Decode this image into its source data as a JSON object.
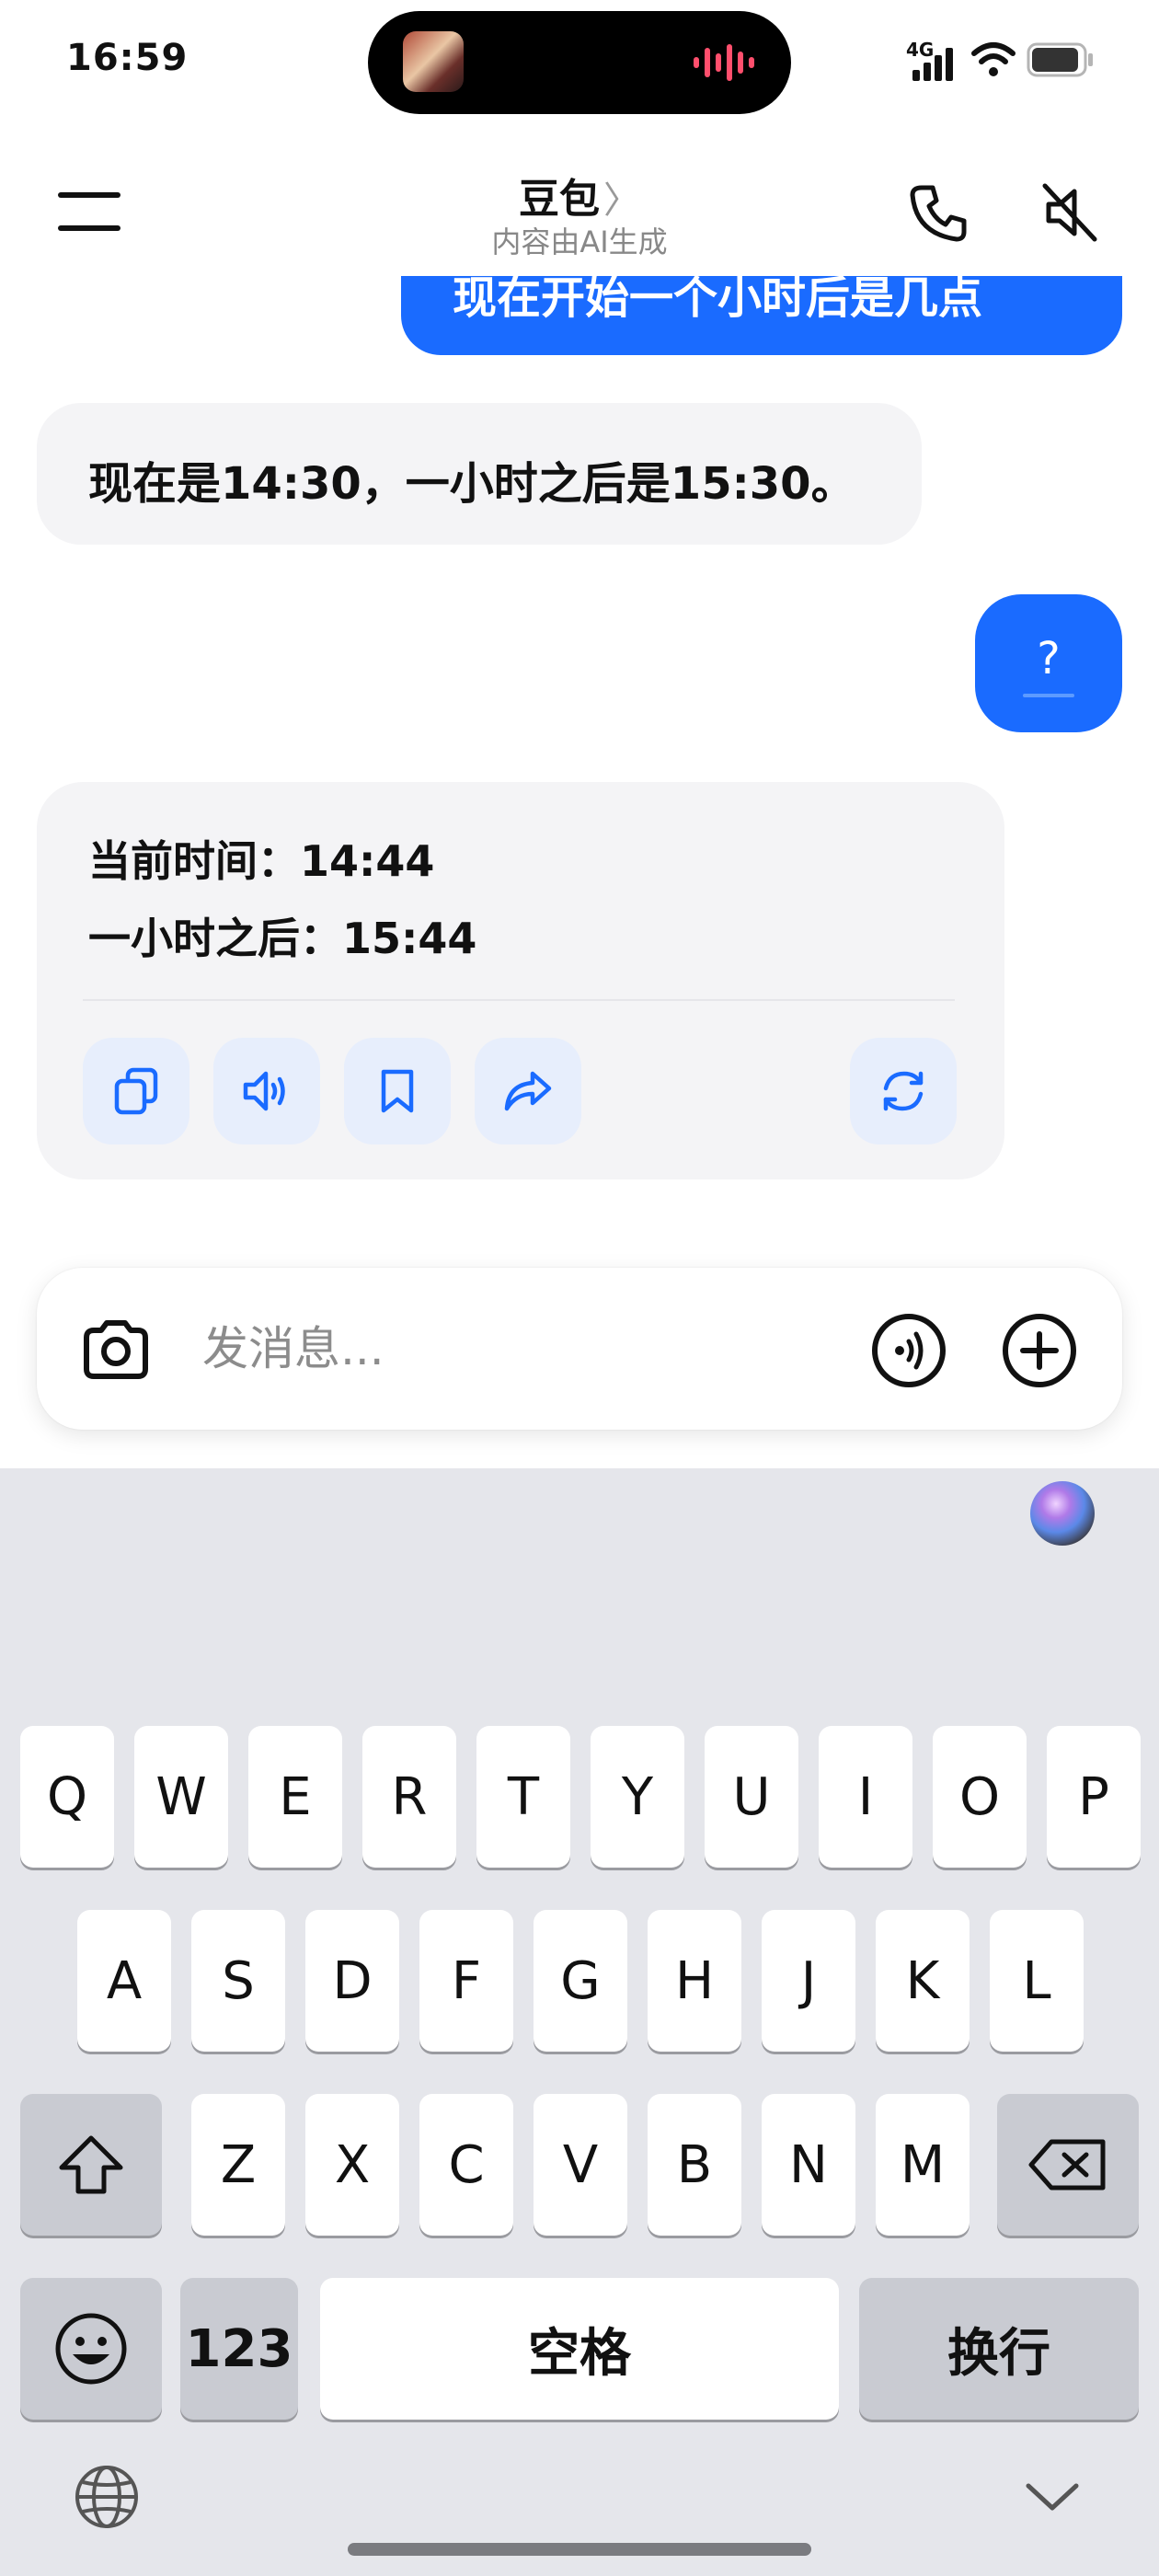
{
  "status_bar": {
    "time": "16:59",
    "network": "4G",
    "colors": {
      "wave": "#ff4f6d"
    },
    "icons": [
      "music-artwork-icon",
      "audio-wave-icon",
      "signal-icon",
      "wifi-icon",
      "battery-icon"
    ]
  },
  "header": {
    "title": "豆包",
    "title_chevron": "〉",
    "subtitle": "内容由AI生成",
    "icons": [
      "menu-icon",
      "phone-icon",
      "speaker-mute-icon"
    ]
  },
  "messages": {
    "user_partial": "现在开始一个小时后是几点",
    "ai_reply_1": "现在是14:30，一小时之后是15:30。",
    "user_question": "?",
    "ai_reply_2": {
      "line1": "当前时间：14:44",
      "line2": "一小时之后：15:44",
      "actions": [
        "copy-icon",
        "speaker-icon",
        "bookmark-icon",
        "share-icon",
        "regenerate-icon"
      ]
    }
  },
  "input_bar": {
    "placeholder": "发消息...",
    "value": "",
    "icons": [
      "camera-icon",
      "voice-call-icon",
      "plus-icon"
    ]
  },
  "keyboard": {
    "row1": [
      "Q",
      "W",
      "E",
      "R",
      "T",
      "Y",
      "U",
      "I",
      "O",
      "P"
    ],
    "row2": [
      "A",
      "S",
      "D",
      "F",
      "G",
      "H",
      "J",
      "K",
      "L"
    ],
    "row3": [
      "Z",
      "X",
      "C",
      "V",
      "B",
      "N",
      "M"
    ],
    "numbers_label": "123",
    "space_label": "空格",
    "return_label": "换行",
    "icons": [
      "shift-icon",
      "backspace-icon",
      "emoji-icon",
      "globe-icon",
      "keyboard-dismiss-icon",
      "siri-icon"
    ]
  },
  "colors": {
    "accent": "#1a6bff",
    "bubble_ai": "#f4f4f6",
    "action_button": "#e7eefc",
    "keyboard_bg": "#e5e6eb"
  }
}
